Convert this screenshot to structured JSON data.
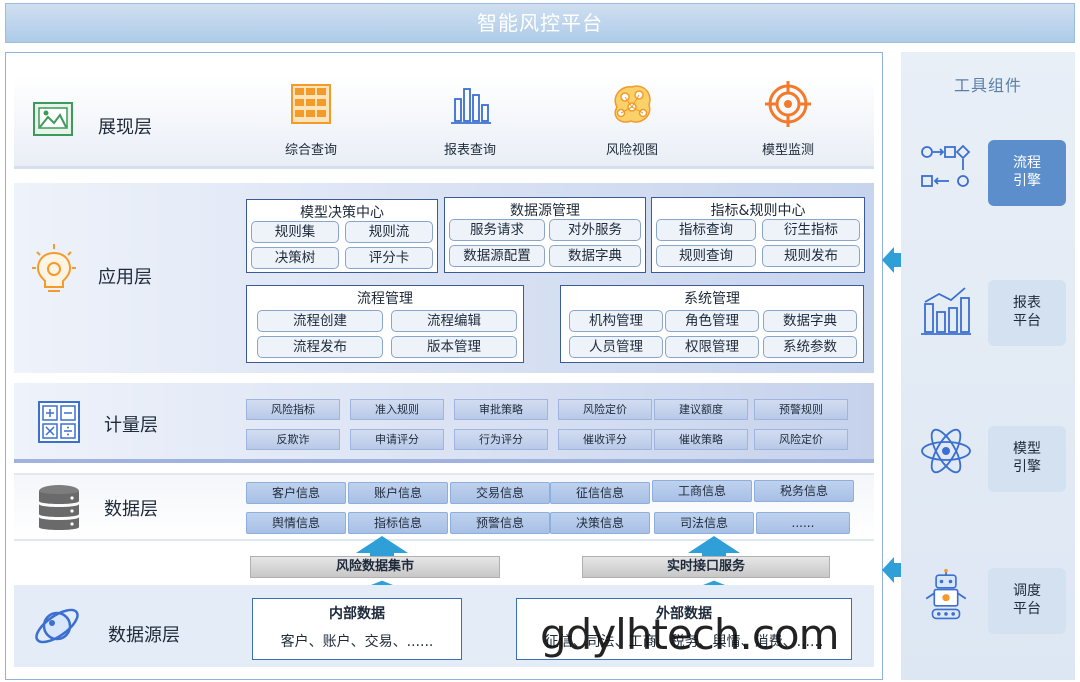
{
  "title": "智能风控平台",
  "layers": {
    "presentation": {
      "name": "展现层",
      "items": [
        {
          "label": "综合查询",
          "icon": "grid-icon"
        },
        {
          "label": "报表查询",
          "icon": "bar-chart-icon"
        },
        {
          "label": "风险视图",
          "icon": "network-icon"
        },
        {
          "label": "模型监测",
          "icon": "target-icon"
        }
      ]
    },
    "application": {
      "name": "应用层",
      "groups": {
        "model_center": {
          "title": "模型决策中心",
          "items": [
            "规则集",
            "规则流",
            "决策树",
            "评分卡"
          ]
        },
        "datasource": {
          "title": "数据源管理",
          "items": [
            "服务请求",
            "对外服务",
            "数据源配置",
            "数据字典"
          ]
        },
        "indicator": {
          "title": "指标&规则中心",
          "items": [
            "指标查询",
            "衍生指标",
            "规则查询",
            "规则发布"
          ]
        },
        "process": {
          "title": "流程管理",
          "items": [
            "流程创建",
            "流程编辑",
            "流程发布",
            "版本管理"
          ]
        },
        "system": {
          "title": "系统管理",
          "items": [
            "机构管理",
            "角色管理",
            "数据字典",
            "人员管理",
            "权限管理",
            "系统参数"
          ]
        }
      }
    },
    "calculation": {
      "name": "计量层",
      "row1": [
        "风险指标",
        "准入规则",
        "审批策略",
        "风险定价",
        "建议额度",
        "预警规则"
      ],
      "row2": [
        "反欺诈",
        "申请评分",
        "行为评分",
        "催收评分",
        "催收策略",
        "风险定价"
      ]
    },
    "data": {
      "name": "数据层",
      "row1": [
        "客户信息",
        "账户信息",
        "交易信息",
        "征信信息",
        "工商信息",
        "税务信息"
      ],
      "row2": [
        "舆情信息",
        "指标信息",
        "预警信息",
        "决策信息",
        "司法信息",
        "......"
      ]
    },
    "bridges": {
      "left": "风险数据集市",
      "right": "实时接口服务"
    },
    "source": {
      "name": "数据源层",
      "internal": {
        "title": "内部数据",
        "value": "客户、账户、交易、......"
      },
      "external": {
        "title": "外部数据",
        "value": "征信、司法、工商、税务、舆情、消费、......"
      }
    }
  },
  "tools": {
    "title": "工具组件",
    "items": [
      {
        "label": "流程\n引擎",
        "icon": "flow-icon",
        "active": true
      },
      {
        "label": "报表\n平台",
        "icon": "report-icon",
        "active": false
      },
      {
        "label": "模型\n引擎",
        "icon": "atom-icon",
        "active": false
      },
      {
        "label": "调度\n平台",
        "icon": "robot-icon",
        "active": false
      }
    ]
  },
  "watermark": "gdylhtech.com",
  "colors": {
    "accent": "#5b8ecb",
    "arrow": "#2f9fd8",
    "icon_orange": "#f39a2b",
    "icon_green": "#3e9a5a",
    "icon_blue": "#3b6fd0"
  }
}
